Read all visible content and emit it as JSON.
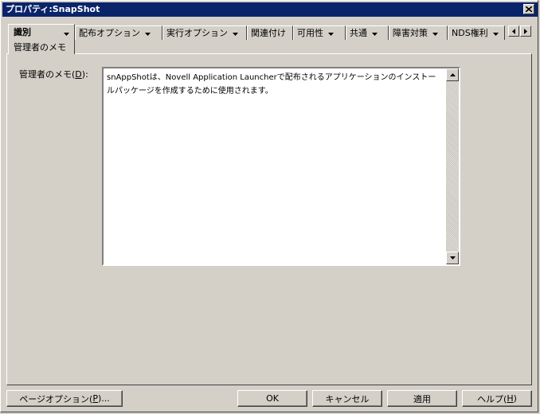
{
  "window": {
    "title": "プロパティ:SnapShot"
  },
  "tabs": [
    {
      "label": "識別",
      "sub": "管理者のメモ",
      "active": true
    },
    {
      "label": "配布オプション"
    },
    {
      "label": "実行オプション"
    },
    {
      "label": "関連付け"
    },
    {
      "label": "可用性"
    },
    {
      "label": "共通"
    },
    {
      "label": "障害対策"
    },
    {
      "label": "NDS権利"
    }
  ],
  "memo": {
    "label_pre": "管理者のメモ(",
    "label_key": "D",
    "label_post": "):",
    "text": "snAppShotは、Novell Application Launcherで配布されるアプリケーションのインストールパッケージを作成するために使用されます。"
  },
  "buttons": {
    "page_options_pre": "ページオプション(",
    "page_options_key": "P",
    "page_options_post": ")...",
    "ok": "OK",
    "cancel": "キャンセル",
    "apply": "適用",
    "help_pre": "ヘルプ(",
    "help_key": "H",
    "help_post": ")"
  },
  "colors": {
    "titlebar": "#0a246a",
    "face": "#d4d0c8"
  }
}
